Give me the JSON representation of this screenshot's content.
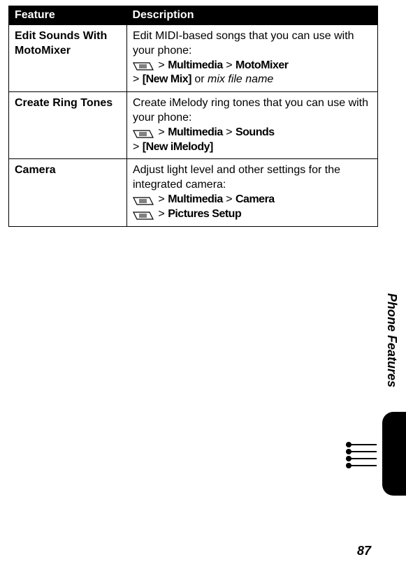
{
  "table": {
    "headers": {
      "feature": "Feature",
      "description": "Description"
    },
    "rows": [
      {
        "feature": "Edit Sounds With MotoMixer",
        "desc_line1": "Edit MIDI-based songs that you can use with your phone:",
        "path1_a": "Multimedia",
        "path1_b": "MotoMixer",
        "path2_a": "[New Mix]",
        "path2_or": " or ",
        "path2_b": "mix file name"
      },
      {
        "feature": "Create Ring Tones",
        "desc_line1": "Create iMelody ring tones that you can use with your phone:",
        "path1_a": "Multimedia",
        "path1_b": "Sounds",
        "path2_a": "[New iMelody]"
      },
      {
        "feature": "Camera",
        "desc_line1": "Adjust light level and other settings for the integrated camera:",
        "path1_a": "Multimedia",
        "path1_b": "Camera",
        "path2_a": "Pictures Setup"
      }
    ]
  },
  "side_label": "Phone Features",
  "page_number": "87"
}
